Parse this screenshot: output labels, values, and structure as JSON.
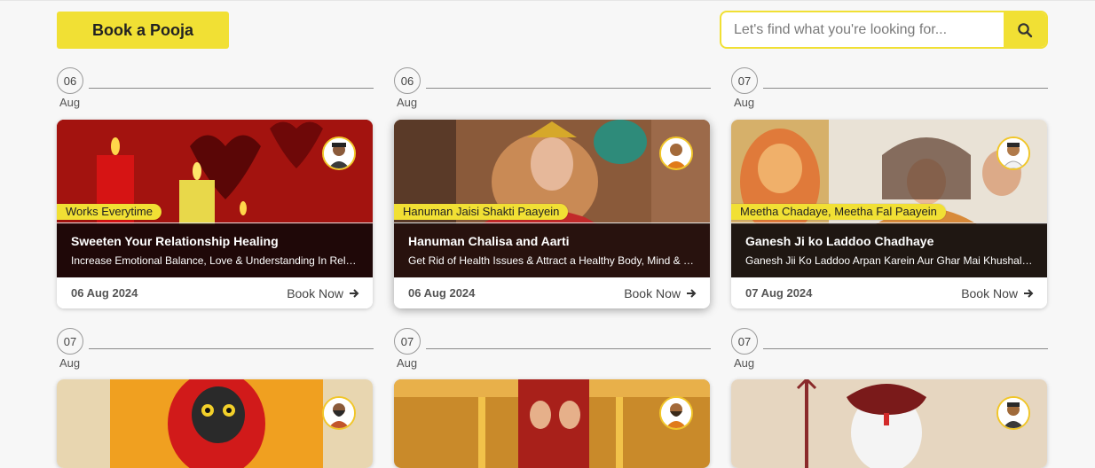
{
  "header": {
    "book_pooja_label": "Book a Pooja",
    "search_placeholder": "Let's find what you're looking for...",
    "search_icon": "search-icon"
  },
  "colors": {
    "accent": "#f1e034",
    "text": "#333333",
    "background": "#f7f7f7"
  },
  "row1": [
    {
      "day": "06",
      "month": "Aug",
      "tag": "Works Everytime",
      "title": "Sweeten Your Relationship Healing",
      "desc": "Increase Emotional Balance, Love & Understanding In Relationships",
      "date": "06 Aug 2024",
      "cta": "Book Now"
    },
    {
      "day": "06",
      "month": "Aug",
      "tag": "Hanuman Jaisi Shakti Paayein",
      "title": "Hanuman Chalisa and Aarti",
      "desc": "Get Rid of Health Issues & Attract a Healthy Body, Mind & Soul",
      "date": "06 Aug 2024",
      "cta": "Book Now"
    },
    {
      "day": "07",
      "month": "Aug",
      "tag": "Meetha Chadaye, Meetha Fal Paayein",
      "title": "Ganesh Ji ko Laddoo Chadhaye",
      "desc": "Ganesh Jii Ko Laddoo Arpan Karein Aur Ghar Mai Khushali Laayein",
      "date": "07 Aug 2024",
      "cta": "Book Now"
    }
  ],
  "row2": [
    {
      "day": "07",
      "month": "Aug"
    },
    {
      "day": "07",
      "month": "Aug"
    },
    {
      "day": "07",
      "month": "Aug"
    }
  ]
}
